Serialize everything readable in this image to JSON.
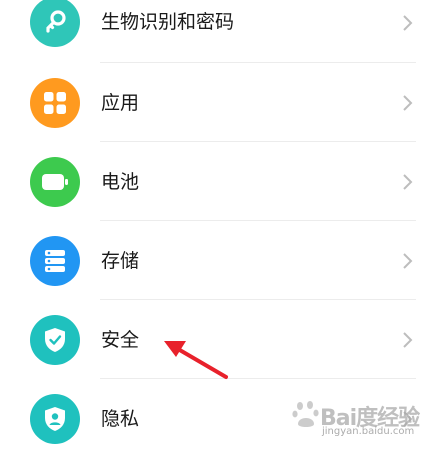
{
  "settings": {
    "items": [
      {
        "label": "生物识别和密码",
        "icon": "key-icon",
        "color": "#2fc6b8"
      },
      {
        "label": "应用",
        "icon": "apps-grid-icon",
        "color": "#ff9a1f"
      },
      {
        "label": "电池",
        "icon": "battery-icon",
        "color": "#3dca4e"
      },
      {
        "label": "存储",
        "icon": "storage-icon",
        "color": "#2196f3"
      },
      {
        "label": "安全",
        "icon": "shield-check-icon",
        "color": "#1fc1be"
      },
      {
        "label": "隐私",
        "icon": "privacy-shield-icon",
        "color": "#1fc1be"
      }
    ]
  },
  "annotation": {
    "arrow_color": "#e8212b"
  },
  "watermark": {
    "brand": "Bai度经验",
    "url": "jingyan.baidu.com"
  }
}
